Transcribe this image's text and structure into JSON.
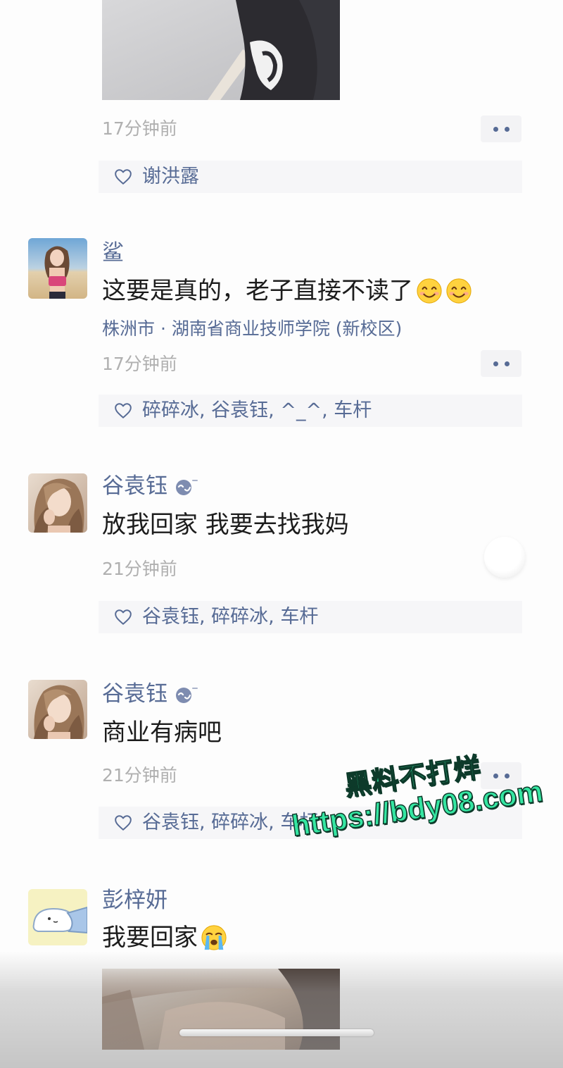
{
  "colors": {
    "link": "#576b95",
    "text": "#1c1c1c",
    "time": "#b0b0b0",
    "like_bg": "#f6f6f8",
    "more_bg": "#f3f3f5",
    "watermark": "#35e6a2"
  },
  "feed": {
    "top_item": {
      "image": "photo-thumbnail",
      "time": "17分钟前",
      "likes": "谢洪露"
    },
    "comments": [
      {
        "name": "鲨",
        "text": "这要是真的，老子直接不读了",
        "emojis": [
          "smile-emoji",
          "smile-emoji"
        ],
        "location": "株洲市 · 湖南省商业技师学院 (新校区)",
        "time": "17分钟前",
        "likes": "碎碎冰, 谷袁钰, ^_^, 车杆"
      },
      {
        "name": "谷袁钰",
        "badge": "status-face-icon",
        "text": "放我回家 我要去找我妈",
        "time": "21分钟前",
        "likes": "谷袁钰, 碎碎冰, 车杆"
      },
      {
        "name": "谷袁钰",
        "badge": "status-face-icon",
        "text": "商业有病吧",
        "time": "21分钟前",
        "likes": "谷袁钰, 碎碎冰, 车杆"
      },
      {
        "name": "彭梓妍",
        "text": "我要回家",
        "emojis": [
          "crying-emoji"
        ],
        "image": "photo-thumbnail"
      }
    ]
  },
  "watermark": {
    "line1": "黑料不打烊",
    "line2": "https://bdy08.com"
  }
}
